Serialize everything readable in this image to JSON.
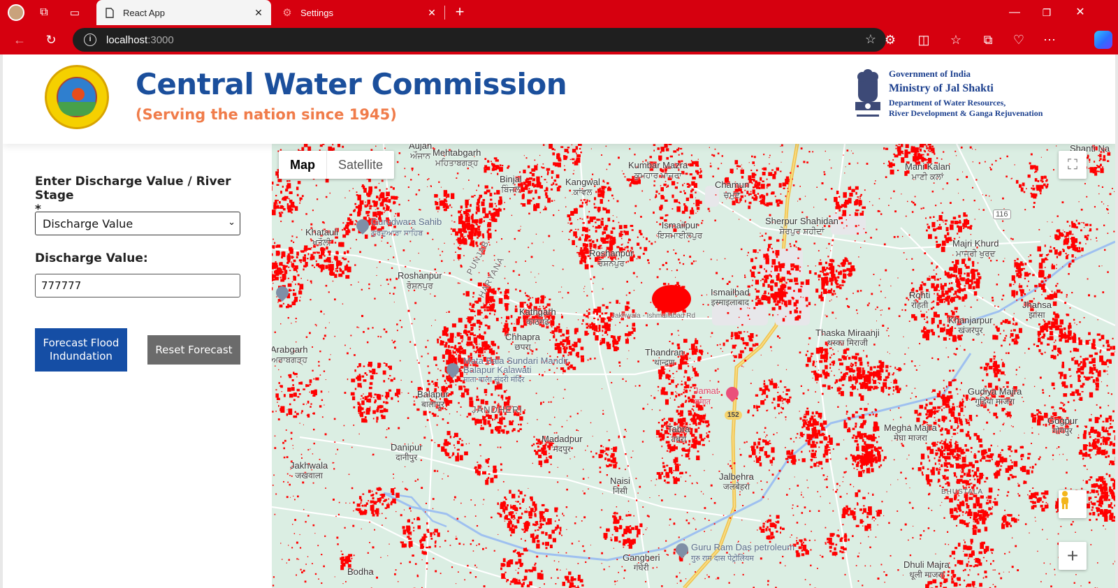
{
  "browser": {
    "tabs": [
      {
        "title": "React App",
        "active": true
      },
      {
        "title": "Settings",
        "active": false
      }
    ],
    "address": {
      "host": "localhost",
      "port": ":3000"
    },
    "chrome_color": "#d6000f"
  },
  "header": {
    "title": "Central Water Commission",
    "subtitle": "(Serving the nation since 1945)",
    "gov_lines": [
      "Government of India",
      "Ministry of Jal Shakti",
      "Department of Water Resources,",
      "River Development & Ganga Rejuvenation"
    ],
    "title_color": "#1b4f9c",
    "subtitle_color": "#f07c4a"
  },
  "form": {
    "mode_label": "Enter Discharge Value / River Stage",
    "mode_required": "*",
    "mode_selected": "Discharge Value",
    "value_label": "Discharge Value:",
    "value": "777777",
    "forecast_button": "Forecast Flood Indundation",
    "reset_button": "Reset Forecast",
    "primary_color": "#154ea5"
  },
  "map": {
    "type_options": [
      "Map",
      "Satellite"
    ],
    "selected_type": "Map",
    "overlay_color": "#ff0000",
    "places": [
      {
        "en": "Aujan",
        "hi": "ਔਜਾਨ"
      },
      {
        "en": "Mehtabgarh",
        "hi": "ਮਹਿਤਾਬਗੜ੍ਹ"
      },
      {
        "en": "Binjal",
        "hi": "ਬਿੰਜਲ"
      },
      {
        "en": "Kangwal",
        "hi": "ਕਾਂਵਲ"
      },
      {
        "en": "Kumbar Mazra",
        "hi": "ਕੁਮਹਾਰ ਮਾਜਰਾ"
      },
      {
        "en": "Chamun",
        "hi": "ਚਮੁਣ"
      },
      {
        "en": "Mani Kalan",
        "hi": "ਮਾਣੀ ਕਲਾਂ"
      },
      {
        "en": "Khatauli",
        "hi": "ਖਤੌਲੀ"
      },
      {
        "en": "Ismailpur",
        "hi": "ਇਸਮਾਈਲਪੁਰ"
      },
      {
        "en": "Sherpur Shahidan",
        "hi": "ਸ਼ੇਰਪੁਰ ਸ਼ਹੀਦਾਂ"
      },
      {
        "en": "Majri Khurd",
        "hi": "ਮਾਜਰੀ ਖੁਰਦ"
      },
      {
        "en": "Roshanpur",
        "hi": "ਰੋਸ਼ਨਪੁਰ"
      },
      {
        "en": "Roshanpur",
        "hi": "ਰੋਸ਼ਨਪੁਰ"
      },
      {
        "en": "Ismailbad",
        "hi": "इस्माइलाबाद"
      },
      {
        "en": "Rohti",
        "hi": "रोहती"
      },
      {
        "en": "Jhansa",
        "hi": "झांसा"
      },
      {
        "en": "Kathgarh",
        "hi": "काठगढ़"
      },
      {
        "en": "Chhapra",
        "hi": "छपरा"
      },
      {
        "en": "Thaska Miraanji",
        "hi": "थस्का मिराजी"
      },
      {
        "en": "Khanjarpur",
        "hi": "खंजरपुर"
      },
      {
        "en": "Arabgarh",
        "hi": "ਅਰਾਬਗੜ੍ਹ"
      },
      {
        "en": "Thandran",
        "hi": "थान्द्रण"
      },
      {
        "en": "Balapur",
        "hi": "बालापुर"
      },
      {
        "en": "Gudiya Majra",
        "hi": "गुड़िया माजरा"
      },
      {
        "en": "Gogpur",
        "hi": "गोगपुर"
      },
      {
        "en": "Tabra",
        "hi": "तबरा"
      },
      {
        "en": "Madadpur",
        "hi": "मदपुर"
      },
      {
        "en": "Megha Majra",
        "hi": "मेघा माजरा"
      },
      {
        "en": "Danipur",
        "hi": "दानीपुर"
      },
      {
        "en": "Jakhwala",
        "hi": "जखवाला"
      },
      {
        "en": "Naisi",
        "hi": "निसी"
      },
      {
        "en": "Jalbehra",
        "hi": "जलबेहरा"
      },
      {
        "en": "Gangheri",
        "hi": "गंघेरी"
      },
      {
        "en": "Bodha",
        "hi": ""
      },
      {
        "en": "Dhuli Majra",
        "hi": "धूली माजरा"
      },
      {
        "en": "Shanti Na",
        "hi": ""
      }
    ],
    "pois": [
      {
        "name": "Gurudwara Sahib",
        "sub": "ਗੁਰਦੁਆਰਾ ਸਾਹਿਬ"
      },
      {
        "name": "Mata Bala Sundari Mandir Balapur Kalawati",
        "sub": "माता बाला सुंदरी मंदिर"
      },
      {
        "name": "Jamat",
        "sub": "जमात"
      },
      {
        "name": "Guru Ram Das petroleum",
        "sub": "गुरु राम दास पेट्रोलियम"
      }
    ],
    "regions": [
      "PUNJAB",
      "HARYANA",
      "JANDHERI",
      "BHUSTALA"
    ],
    "roads": [
      "Jakhwala - Ishmailabad Rd"
    ],
    "highways": [
      "116",
      "152"
    ]
  }
}
